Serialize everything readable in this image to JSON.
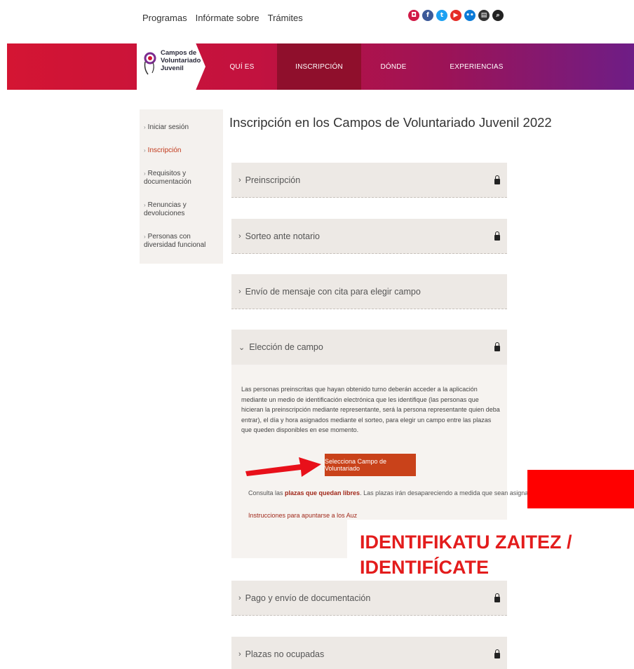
{
  "topnav": {
    "items": [
      "Programas",
      "Infórmate sobre",
      "Trámites"
    ]
  },
  "social": {
    "icons": [
      {
        "name": "instagram-icon",
        "glyph": "◘",
        "color": "#d11a47"
      },
      {
        "name": "facebook-icon",
        "glyph": "f",
        "color": "#3b5998"
      },
      {
        "name": "twitter-icon",
        "glyph": "t",
        "color": "#1da1f2"
      },
      {
        "name": "youtube-icon",
        "glyph": "▶",
        "color": "#e52d27"
      },
      {
        "name": "flickr-icon",
        "glyph": "••",
        "color": "#0c7bd8"
      },
      {
        "name": "blog-icon",
        "glyph": "▤",
        "color": "#333333"
      },
      {
        "name": "search-icon",
        "glyph": "⌕",
        "color": "#222222"
      }
    ]
  },
  "logo": {
    "line1": "Campos de",
    "line2": "Voluntariado",
    "line3": "Juvenil"
  },
  "mainnav": {
    "quien": "QUÍ ES",
    "inscripcion": "INSCRIPCIÓN",
    "donde": "DÓNDE",
    "experiencias": "EXPERIENCIAS"
  },
  "sidebar": {
    "items": [
      {
        "label": "Iniciar sesión"
      },
      {
        "label": "Inscripción"
      },
      {
        "label": "Requisitos y documentación"
      },
      {
        "label": "Renuncias y devoluciones"
      },
      {
        "label": "Personas con diversidad funcional"
      }
    ]
  },
  "main": {
    "title": "Inscripción en los Campos de Voluntariado Juvenil 2022",
    "sections": [
      {
        "label": "Preinscripción"
      },
      {
        "label": "Sorteo ante notario"
      },
      {
        "label": "Envío de mensaje con cita para elegir campo"
      },
      {
        "label": "Elección de campo"
      },
      {
        "label": "Pago y envío de documentación"
      },
      {
        "label": "Plazas no ocupadas"
      }
    ],
    "panel_text": "Las personas preinscritas que hayan obtenido turno deberán acceder a la aplicación mediante un medio de identificación electrónica que les identifique (las personas que hicieran la preinscripción mediante representante, será la persona representante quien deba entrar), el día y hora asignados mediante el sorteo, para elegir un campo entre las plazas que queden disponibles en ese momento.",
    "cta_label": "Selecciona Campo de Voluntariado",
    "note1_pre": "Consulta las ",
    "note1_link": "plazas que quedan libres",
    "note1_post": ". Las plazas irán desapareciendo a medida que sean asignadas.",
    "note2": "Instrucciones para apuntarse a los Auz"
  },
  "overlay": {
    "line1": "IDENTIFIKATU ZAITEZ /",
    "line2": "IDENTIFÍCATE"
  }
}
